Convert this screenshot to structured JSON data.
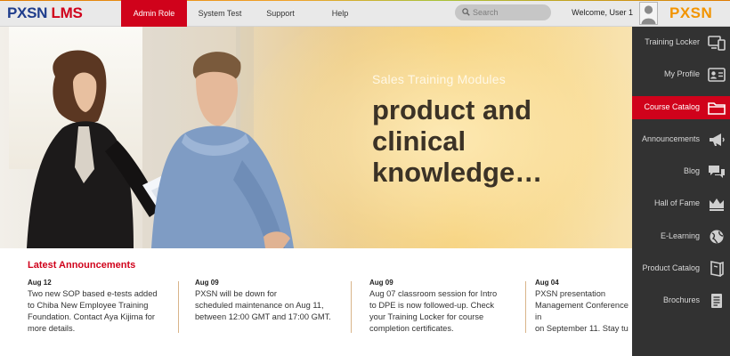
{
  "header": {
    "logo_part1": "PXSN",
    "logo_part2": "LMS",
    "nav": [
      {
        "label": "Admin Role",
        "active": true
      },
      {
        "label": "System Test",
        "active": false
      },
      {
        "label": "Support",
        "active": false
      },
      {
        "label": "Help",
        "active": false
      }
    ],
    "search_placeholder": "Search",
    "welcome": "Welcome, User 1",
    "brand": "PXSN"
  },
  "hero": {
    "eyebrow": "Sales Training Modules",
    "headline_line1": "product and",
    "headline_line2": "clinical knowledge…"
  },
  "sidebar": {
    "items": [
      {
        "label": "Training Locker",
        "icon": "devices-icon",
        "active": false
      },
      {
        "label": "My Profile",
        "icon": "profile-card-icon",
        "active": false
      },
      {
        "label": "Course Catalog",
        "icon": "folder-icon",
        "active": true
      },
      {
        "label": "Announcements",
        "icon": "megaphone-icon",
        "active": false
      },
      {
        "label": "Blog",
        "icon": "chat-bubbles-icon",
        "active": false
      },
      {
        "label": "Hall of Fame",
        "icon": "crown-icon",
        "active": false
      },
      {
        "label": "E-Learning",
        "icon": "globe-icon",
        "active": false
      },
      {
        "label": "Product Catalog",
        "icon": "book-icon",
        "active": false
      },
      {
        "label": "Brochures",
        "icon": "document-icon",
        "active": false
      }
    ]
  },
  "announcements": {
    "title": "Latest Announcements",
    "items": [
      {
        "date": "Aug 12",
        "text": "Two new SOP based e-tests added\nto Chiba New Employee Training\nFoundation. Contact Aya Kijima for\nmore  details."
      },
      {
        "date": "Aug 09",
        "text": "PXSN will be down for\nscheduled maintenance on Aug 11,\nbetween 12:00 GMT and 17:00 GMT."
      },
      {
        "date": "Aug 09",
        "text": "Aug 07 classroom session for Intro\nto DPE is now followed-up. Check\nyour Training Locker for course\ncompletion certificates."
      },
      {
        "date": "Aug 04",
        "text": "PXSN presentation\nManagement Conference in\non September 11. Stay tu"
      }
    ]
  },
  "colors": {
    "accent_red": "#d0021b",
    "logo_blue": "#1f3d8c",
    "brand_orange": "#f29400",
    "sidebar_bg": "#323232"
  }
}
